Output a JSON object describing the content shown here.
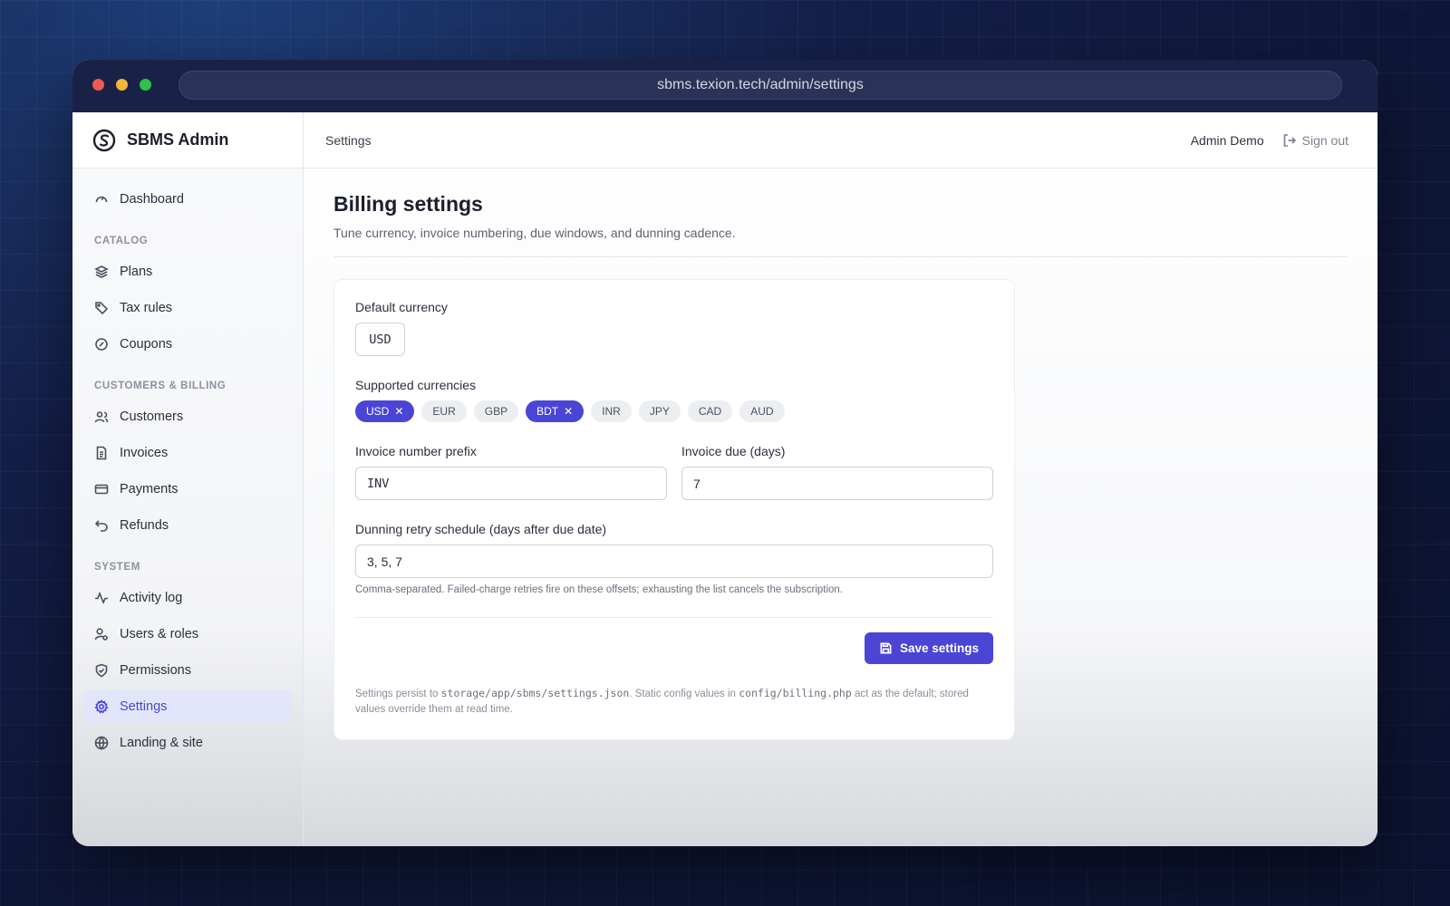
{
  "browser": {
    "url": "sbms.texion.tech/admin/settings"
  },
  "brand": {
    "name": "SBMS Admin"
  },
  "sidebar": {
    "dashboard": "Dashboard",
    "catalog_heading": "CATALOG",
    "catalog": [
      "Plans",
      "Tax rules",
      "Coupons"
    ],
    "billing_heading": "CUSTOMERS & BILLING",
    "billing": [
      "Customers",
      "Invoices",
      "Payments",
      "Refunds"
    ],
    "system_heading": "SYSTEM",
    "system": [
      "Activity log",
      "Users & roles",
      "Permissions",
      "Settings",
      "Landing & site"
    ],
    "active": "Settings"
  },
  "topbar": {
    "breadcrumb": "Settings",
    "user": "Admin Demo",
    "sign_out": "Sign out"
  },
  "page": {
    "title": "Billing settings",
    "subtitle": "Tune currency, invoice numbering, due windows, and dunning cadence."
  },
  "form": {
    "default_currency_label": "Default currency",
    "default_currency_value": "USD",
    "supported_label": "Supported currencies",
    "currencies": [
      {
        "code": "USD",
        "selected": true
      },
      {
        "code": "EUR",
        "selected": false
      },
      {
        "code": "GBP",
        "selected": false
      },
      {
        "code": "BDT",
        "selected": true
      },
      {
        "code": "INR",
        "selected": false
      },
      {
        "code": "JPY",
        "selected": false
      },
      {
        "code": "CAD",
        "selected": false
      },
      {
        "code": "AUD",
        "selected": false
      }
    ],
    "prefix_label": "Invoice number prefix",
    "prefix_value": "INV",
    "due_label": "Invoice due (days)",
    "due_value": "7",
    "dunning_label": "Dunning retry schedule (days after due date)",
    "dunning_value": "3, 5, 7",
    "dunning_help": "Comma-separated. Failed-charge retries fire on these offsets; exhausting the list cancels the subscription.",
    "save_label": "Save settings"
  },
  "footnote": {
    "part1": "Settings persist to ",
    "path1": "storage/app/sbms/settings.json",
    "part2": ". Static config values in ",
    "path2": "config/billing.php",
    "part3": " act as the default; stored values override them at read time."
  },
  "colors": {
    "accent": "#4b45d6",
    "active_bg": "#e3e6fb"
  }
}
